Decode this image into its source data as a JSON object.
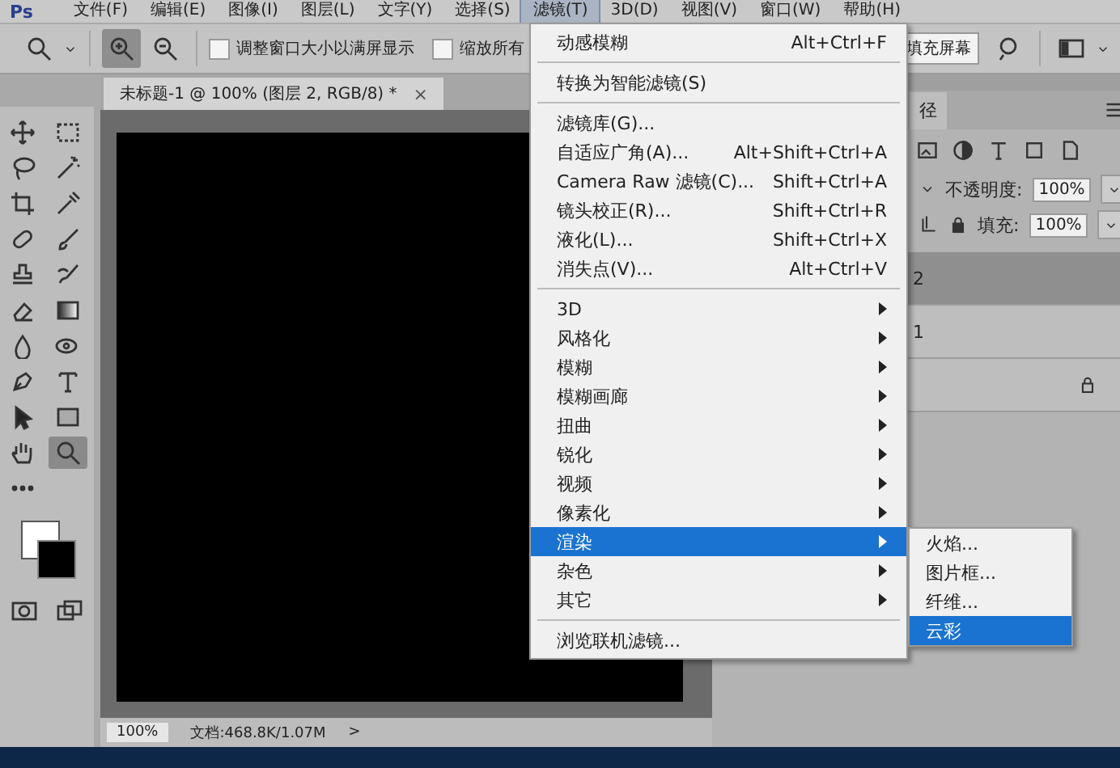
{
  "menubar": {
    "logo": "Ps",
    "items": [
      {
        "label": "文件(F)",
        "selected": false
      },
      {
        "label": "编辑(E)",
        "selected": false
      },
      {
        "label": "图像(I)",
        "selected": false
      },
      {
        "label": "图层(L)",
        "selected": false
      },
      {
        "label": "文字(Y)",
        "selected": false
      },
      {
        "label": "选择(S)",
        "selected": false
      },
      {
        "label": "滤镜(T)",
        "selected": true
      },
      {
        "label": "3D(D)",
        "selected": false
      },
      {
        "label": "视图(V)",
        "selected": false
      },
      {
        "label": "窗口(W)",
        "selected": false
      },
      {
        "label": "帮助(H)",
        "selected": false
      }
    ]
  },
  "options_bar": {
    "zoom_in_selected": true,
    "checkboxes": [
      {
        "label": "调整窗口大小以满屏显示",
        "checked": false
      },
      {
        "label": "缩放所有",
        "checked": false
      }
    ],
    "fill_screen_button": "填充屏幕"
  },
  "tools": [
    {
      "kind": "move",
      "selected": false
    },
    {
      "kind": "marquee",
      "selected": false
    },
    {
      "kind": "lasso",
      "selected": false
    },
    {
      "kind": "wand",
      "selected": false
    },
    {
      "kind": "crop",
      "selected": false
    },
    {
      "kind": "eyedropper",
      "selected": false
    },
    {
      "kind": "healing",
      "selected": false
    },
    {
      "kind": "brush",
      "selected": false
    },
    {
      "kind": "stamp",
      "selected": false
    },
    {
      "kind": "history",
      "selected": false
    },
    {
      "kind": "eraser",
      "selected": false
    },
    {
      "kind": "gradient",
      "selected": false
    },
    {
      "kind": "blur",
      "selected": false
    },
    {
      "kind": "dodge",
      "selected": false
    },
    {
      "kind": "pen",
      "selected": false
    },
    {
      "kind": "type",
      "selected": false
    },
    {
      "kind": "select",
      "selected": false
    },
    {
      "kind": "rect",
      "selected": false
    },
    {
      "kind": "hand",
      "selected": false
    },
    {
      "kind": "zoom",
      "selected": true
    },
    {
      "kind": "more",
      "selected": false
    }
  ],
  "document": {
    "tab_title": "未标题-1 @ 100% (图层 2, RGB/8) *",
    "close": "×",
    "zoom": "100%",
    "doc_info": "文档:468.8K/1.07M",
    "arrow": ">"
  },
  "layers_panel": {
    "tab": "径",
    "opacity_label": "不透明度:",
    "opacity": "100%",
    "fill_label": "填充:",
    "fill": "100%",
    "layers": [
      {
        "label": "2",
        "selected": true,
        "locked": false
      },
      {
        "label": "1",
        "selected": false,
        "locked": false
      },
      {
        "selected": false,
        "locked": true
      }
    ]
  },
  "filter_menu": {
    "items": [
      {
        "kind": "command",
        "label": "动感模糊",
        "shortcut": "Alt+Ctrl+F",
        "selected": false
      },
      {
        "kind": "separator"
      },
      {
        "kind": "command",
        "label": "转换为智能滤镜(S)",
        "selected": false
      },
      {
        "kind": "separator"
      },
      {
        "kind": "command",
        "label": "滤镜库(G)...",
        "selected": false
      },
      {
        "kind": "command",
        "label": "自适应广角(A)...",
        "shortcut": "Alt+Shift+Ctrl+A",
        "selected": false
      },
      {
        "kind": "command",
        "label": "Camera Raw 滤镜(C)...",
        "shortcut": "Shift+Ctrl+A",
        "selected": false
      },
      {
        "kind": "command",
        "label": "镜头校正(R)...",
        "shortcut": "Shift+Ctrl+R",
        "selected": false
      },
      {
        "kind": "command",
        "label": "液化(L)...",
        "shortcut": "Shift+Ctrl+X",
        "selected": false
      },
      {
        "kind": "command",
        "label": "消失点(V)...",
        "shortcut": "Alt+Ctrl+V",
        "selected": false
      },
      {
        "kind": "separator"
      },
      {
        "kind": "submenu",
        "label": "3D",
        "selected": false
      },
      {
        "kind": "submenu",
        "label": "风格化",
        "selected": false
      },
      {
        "kind": "submenu",
        "label": "模糊",
        "selected": false
      },
      {
        "kind": "submenu",
        "label": "模糊画廊",
        "selected": false
      },
      {
        "kind": "submenu",
        "label": "扭曲",
        "selected": false
      },
      {
        "kind": "submenu",
        "label": "锐化",
        "selected": false
      },
      {
        "kind": "submenu",
        "label": "视频",
        "selected": false
      },
      {
        "kind": "submenu",
        "label": "像素化",
        "selected": false
      },
      {
        "kind": "submenu",
        "label": "渲染",
        "selected": true
      },
      {
        "kind": "submenu",
        "label": "杂色",
        "selected": false
      },
      {
        "kind": "submenu",
        "label": "其它",
        "selected": false
      },
      {
        "kind": "separator"
      },
      {
        "kind": "command",
        "label": "浏览联机滤镜...",
        "selected": false
      }
    ]
  },
  "render_submenu": {
    "items": [
      {
        "label": "火焰...",
        "selected": false
      },
      {
        "label": "图片框...",
        "selected": false
      },
      {
        "label": "纤维...",
        "selected": false
      },
      {
        "label": "云彩",
        "selected": true
      }
    ]
  }
}
